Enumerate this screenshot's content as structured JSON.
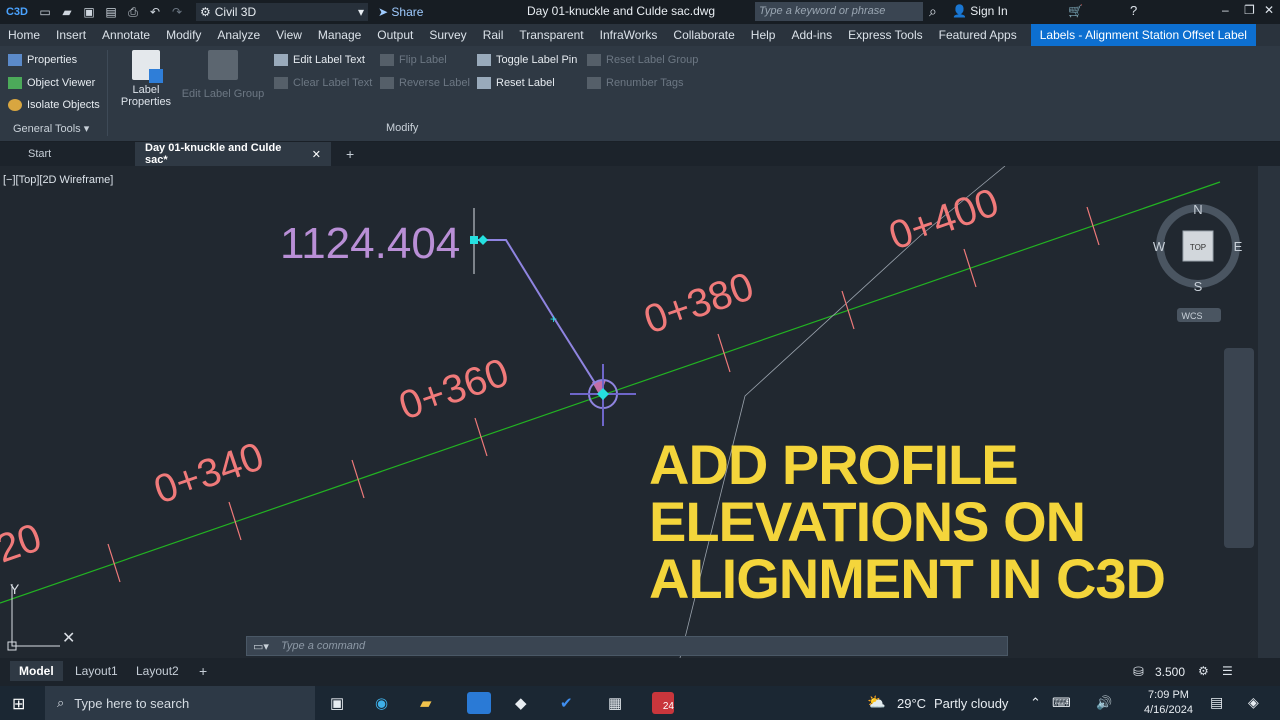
{
  "app": {
    "logo": "C3D",
    "workspace": "Civil 3D",
    "share": "Share",
    "file_title": "Day 01-knuckle and Culde sac.dwg",
    "search_placeholder": "Type a keyword or phrase",
    "sign_in": "Sign In"
  },
  "menu": [
    "Home",
    "Insert",
    "Annotate",
    "Modify",
    "Analyze",
    "View",
    "Manage",
    "Output",
    "Survey",
    "Rail",
    "Transparent",
    "InfraWorks",
    "Collaborate",
    "Help",
    "Add-ins",
    "Express Tools",
    "Featured Apps"
  ],
  "context_tab": "Labels - Alignment Station Offset Label",
  "ribbon": {
    "general": {
      "properties": "Properties",
      "object_viewer": "Object Viewer",
      "isolate_objects": "Isolate Objects",
      "title": "General Tools"
    },
    "label_properties_1": "Label",
    "label_properties_2": "Properties",
    "edit_label_group": "Edit Label Group",
    "edit_label_text": "Edit Label Text",
    "clear_label_text": "Clear Label Text",
    "flip_label": "Flip Label",
    "reverse_label": "Reverse Label",
    "toggle_label_pin": "Toggle Label Pin",
    "reset_label": "Reset Label",
    "reset_label_group": "Reset Label Group",
    "renumber_tags": "Renumber Tags",
    "modify_title": "Modify"
  },
  "doc_tabs": {
    "start": "Start",
    "active": "Day 01-knuckle and Culde sac*",
    "close": "✕",
    "add": "+"
  },
  "viewport": {
    "label": "[−][Top][2D Wireframe]"
  },
  "drawing": {
    "elevation": "1124.404",
    "stations": [
      "20",
      "0+340",
      "0+360",
      "0+380",
      "0+400"
    ],
    "headline": [
      "ADD PROFILE",
      "ELEVATIONS ON",
      "ALIGNMENT IN C3D"
    ],
    "colors": {
      "alignment": "#22b322",
      "station": "#f07a7a",
      "elevation": "#b98fd6",
      "leader": "#8f84e0",
      "headline": "#f4d53b"
    }
  },
  "viewcube": {
    "n": "N",
    "s": "S",
    "e": "E",
    "w": "W",
    "face": "TOP",
    "wcs": "WCS"
  },
  "ucs": {
    "y": "Y"
  },
  "command": {
    "placeholder": "Type a command"
  },
  "layout_tabs": {
    "model": "Model",
    "layout1": "Layout1",
    "layout2": "Layout2",
    "add": "+"
  },
  "status": {
    "scale": "3.500"
  },
  "taskbar": {
    "search": "Type here to search",
    "weather_temp": "29°C",
    "weather_desc": "Partly cloudy",
    "time": "7:09 PM",
    "date": "4/16/2024",
    "badge": "24"
  }
}
